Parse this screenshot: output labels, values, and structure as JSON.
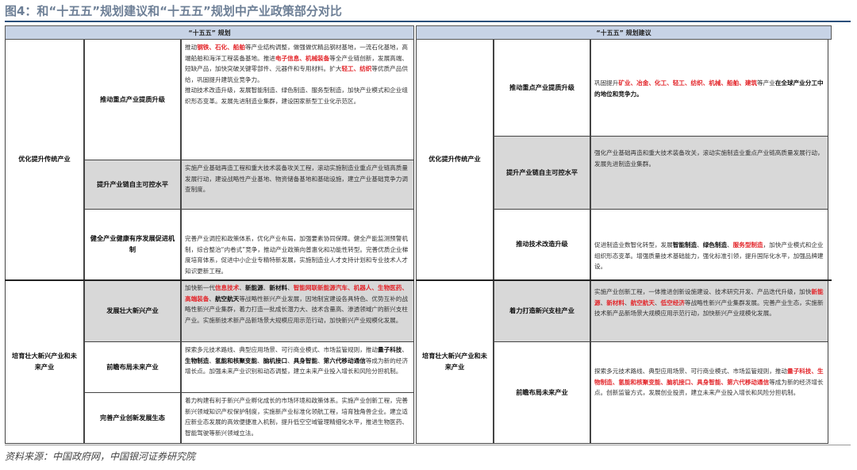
{
  "figure": {
    "title": "图4：和“十五五”规划建议和“十五五”规划中产业政策部分对比",
    "source": "资料来源：中国政府网，中国银河证券研究院"
  },
  "left": {
    "header": "“十五五” 规划",
    "group1": "优化提升传统产业",
    "group2": "培育壮大新兴产业和未来产业",
    "rows": [
      {
        "label": "推动重点产业提质升级",
        "segments": [
          [
            "推动",
            ""
          ],
          [
            "钢铁、石化、船舶",
            "red"
          ],
          [
            "等产业结构调整，做强做优精品钢材基地，一流石化基地，高端船舶和海洋工程装备基地。推进",
            ""
          ],
          [
            "电子信息、机械装备",
            "red"
          ],
          [
            "等全产业链创新，发展高端、短缺产品，加快突破关键零部件、元器件和专用材料。扩大",
            ""
          ],
          [
            "轻工、纺织",
            "red"
          ],
          [
            "等优质产品供给，巩固提升建筑业竞争力。",
            ""
          ],
          [
            "\n推动技术改造升级，发展智能制造、绿色制造、服务型制造，加快产业模式和企业组织形态变革。发展先进制造业集群，建设国家新型工业化示范区。",
            ""
          ]
        ]
      },
      {
        "label": "提升产业链自主可控水平",
        "segments": [
          [
            "实施产业基础再造工程和重大技术装备攻关工程，滚动实施制造业重点产业链高质量发展行动，建设战略性产业基地、物资储备基地和基础设施，建立产业基础竞争力调查制度。",
            ""
          ]
        ]
      },
      {
        "label": "健全产业健康有序发展促进机制",
        "segments": [
          [
            "完善产业调控和政策体系，优化产业布局，加强要素协同保障。健全产能监测预警机制，综合整治“内卷式”竞争，推动产业政策向普惠化和功能性转型。完善优质企业梯度培育体系，促进中小企业专精特新发展，实施制造业人才支持计划和专业技术人才知识更新工程。",
            ""
          ]
        ]
      },
      {
        "label": "发展壮大新兴产业",
        "segments": [
          [
            "加快新一代",
            ""
          ],
          [
            "信息技术",
            "red"
          ],
          [
            "、",
            ""
          ],
          [
            "新能源",
            "blk"
          ],
          [
            "、",
            ""
          ],
          [
            "新材料",
            "blk"
          ],
          [
            "、",
            ""
          ],
          [
            "智能网联新能源汽车、机器人、生物医药、高端装备",
            "red"
          ],
          [
            "、",
            ""
          ],
          [
            "航空航天",
            "blk"
          ],
          [
            "等战略性新兴产业发展，因地制宜建设各具特色、优势互补的战略性新兴产业集群，着力打造一批成长潜力大、技术含量高、渗透领域广的新兴支柱产业。实施新技术新产品新场景大规模应用示范行动，加快新兴产业规模化发展。",
            ""
          ]
        ]
      },
      {
        "label": "前瞻布局未来产业",
        "segments": [
          [
            "探索多元技术路线、典型应用场景、可行商业模式、市场监管规则，推动",
            ""
          ],
          [
            "量子科技",
            "blk"
          ],
          [
            "、",
            ""
          ],
          [
            "生物制造",
            "blk"
          ],
          [
            "、",
            ""
          ],
          [
            "氢能和核聚变能",
            "blk"
          ],
          [
            "、",
            ""
          ],
          [
            "脑机接口",
            "blk"
          ],
          [
            "、",
            ""
          ],
          [
            "具身智能",
            "blk"
          ],
          [
            "、",
            ""
          ],
          [
            "第六代移动通信",
            "blk"
          ],
          [
            "等成为新的经济增长点。加强未来产业识别和动态调整，建立未来产业投入增长和风险分担机制。",
            ""
          ]
        ]
      },
      {
        "label": "完善产业创新发展生态",
        "segments": [
          [
            "着力构建有利于新兴产业孵化成长的市场环境和政策体系。实施产业创新工程，完善新兴领域知识产权保护制度，实施新产业标准化领航工程，培育独角兽企业。建立适应新业态发展的高效便捷准入机制，提升低空空域管理精细化水平，推进生物医药、智能驾驶等新兴领域立法。",
            ""
          ]
        ]
      }
    ]
  },
  "right": {
    "header": "“十五五” 规划建议",
    "group1": "优化提升传统产业",
    "group2": "培育壮大新兴产业和未来产业",
    "rows": [
      {
        "label": "推动重点产业提质升级",
        "segments": [
          [
            "巩固提升",
            ""
          ],
          [
            "矿业、冶金、化工、轻工、纺织、机械、船舶、建筑",
            "red"
          ],
          [
            "等产业",
            ""
          ],
          [
            "在全球产业分工中的地位和竞争力。",
            "blk"
          ]
        ]
      },
      {
        "label": "提升产业链自主可控水平",
        "segments": [
          [
            "强化产业基础再造和重大技术装备攻关，滚动实施制造业重点产业链高质量发展行动，发展先进制造业集群。",
            ""
          ]
        ]
      },
      {
        "label": "推动技术改造升级",
        "segments": [
          [
            "促进制造业数智化转型，发展",
            ""
          ],
          [
            "智能制造",
            "blk"
          ],
          [
            "、",
            ""
          ],
          [
            "绿色制造",
            "blk"
          ],
          [
            "、",
            ""
          ],
          [
            "服务型制造",
            "red"
          ],
          [
            "，加快产业模式和企业组织形态变革。增强质量技术基础能力，强化标准引领，提升国际化水平，加强品牌建设。",
            ""
          ]
        ]
      },
      {
        "label": "着力打造新兴支柱产业",
        "segments": [
          [
            "实施产业创新工程，一体推进创新设施建设、技术研究开发、产品迭代升级，加快",
            ""
          ],
          [
            "新能源",
            "red"
          ],
          [
            "、",
            ""
          ],
          [
            "新材料",
            "red"
          ],
          [
            "、",
            ""
          ],
          [
            "航空航天",
            "red"
          ],
          [
            "、",
            ""
          ],
          [
            "低空经济",
            "red"
          ],
          [
            "等战略性新兴产业集群发展。完善产业生态，实施新技术新产品新场景大规模应用示范行动，加快新兴产业规模化发展。",
            ""
          ]
        ]
      },
      {
        "label": "前瞻布局未来产业",
        "segments": [
          [
            "探索多元技术路线、典型应用场景、可行商业模式、市场监管规则，推动",
            ""
          ],
          [
            "量子科技、生物制造、氢能和核聚变能、脑机接口、具身智能、",
            "red"
          ],
          [
            "第六代移动通信",
            "red"
          ],
          [
            "等成为新的经济增长点。创新监管方式，发展创业投资，建立未来产业投入增长和风险分担机制。",
            ""
          ]
        ]
      }
    ]
  }
}
